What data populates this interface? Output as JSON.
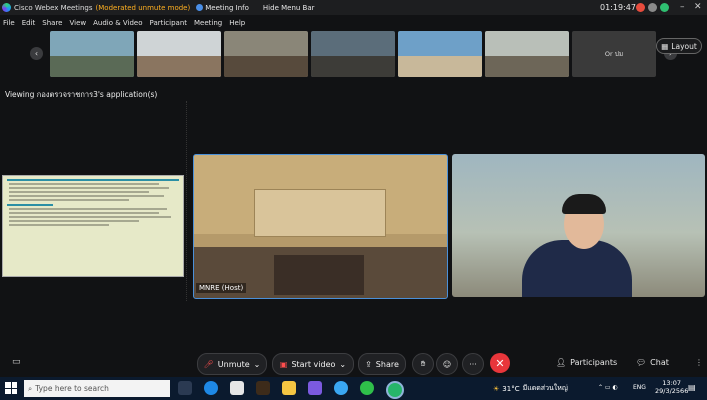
{
  "titlebar": {
    "app_name": "Cisco Webex Meetings",
    "mode": "(Moderated unmute mode)",
    "meeting_info": "Meeting Info",
    "hide_menu": "Hide Menu Bar",
    "time": "01:19:47"
  },
  "menu": [
    "File",
    "Edit",
    "Share",
    "View",
    "Audio & Video",
    "Participant",
    "Meeting",
    "Help"
  ],
  "thumbnails": {
    "last_label": "Or ปม"
  },
  "layout_button": "Layout",
  "viewing_label": "Viewing กองตรวจราชการ3's application(s)",
  "host_label": "MNRE (Host)",
  "controls": {
    "unmute": "Unmute",
    "start_video": "Start video",
    "share": "Share",
    "participants": "Participants",
    "chat": "Chat"
  },
  "taskbar": {
    "search_placeholder": "Type here to search",
    "temperature": "31°C",
    "weather_text": "มีแดดส่วนใหญ่",
    "lang": "ENG",
    "clock_time": "13:07",
    "clock_date": "29/3/2566"
  },
  "colors": {
    "mode_accent": "#ffb020",
    "end_button": "#e8363b",
    "active_speaker_border": "#4a90d9"
  }
}
